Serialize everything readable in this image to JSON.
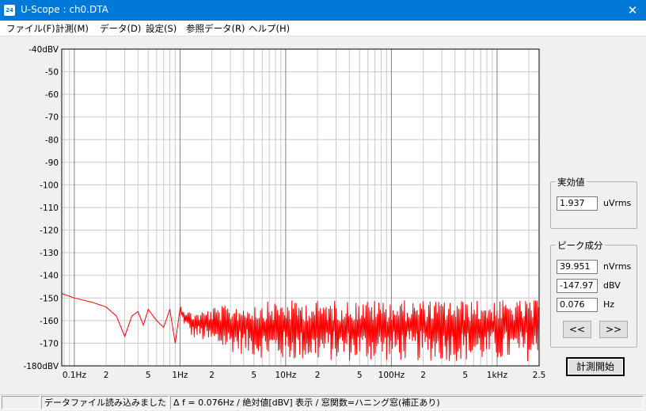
{
  "window": {
    "title": "U-Scope : ch0.DTA",
    "icon_label": "24",
    "close_glyph": "✕"
  },
  "menu": [
    {
      "label": "ファイル(F)"
    },
    {
      "label": "計測(M)"
    },
    {
      "label": "データ(D)"
    },
    {
      "label": "設定(S)"
    },
    {
      "label": "参照データ(R)"
    },
    {
      "label": "ヘルプ(H)"
    }
  ],
  "rms_group": {
    "title": "実効値",
    "value": "1.937",
    "unit": "uVrms"
  },
  "peak_group": {
    "title": "ピーク成分",
    "nvrms_value": "39.951",
    "nvrms_unit": "nVrms",
    "dbv_value": "-147.97",
    "dbv_unit": "dBV",
    "hz_value": "0.076",
    "hz_unit": "Hz",
    "prev_label": "<<",
    "next_label": ">>"
  },
  "start_button": {
    "label": "計測開始"
  },
  "status": {
    "left": "",
    "message": "データファイル読み込みました",
    "info": "Δ f = 0.076Hz / 絶対値[dBV] 表示 / 窓関数=ハニング窓(補正あり)"
  },
  "chart_data": {
    "type": "line",
    "x_scale": "log",
    "xlim": [
      0.076,
      2500
    ],
    "ylim": [
      -180,
      -40
    ],
    "grid": true,
    "line_color": "#ff0000",
    "y_ticks": [
      "-40dBV",
      "-50",
      "-60",
      "-70",
      "-80",
      "-90",
      "-100",
      "-110",
      "-120",
      "-130",
      "-140",
      "-150",
      "-160",
      "-170",
      "-180dBV"
    ],
    "x_ticks": [
      {
        "value": 0.1,
        "label": "0.1Hz"
      },
      {
        "value": 0.2,
        "label": "2"
      },
      {
        "value": 0.5,
        "label": "5"
      },
      {
        "value": 1,
        "label": "1Hz"
      },
      {
        "value": 2,
        "label": "2"
      },
      {
        "value": 5,
        "label": "5"
      },
      {
        "value": 10,
        "label": "10Hz"
      },
      {
        "value": 20,
        "label": "2"
      },
      {
        "value": 50,
        "label": "5"
      },
      {
        "value": 100,
        "label": "100Hz"
      },
      {
        "value": 200,
        "label": "2"
      },
      {
        "value": 500,
        "label": "5"
      },
      {
        "value": 1000,
        "label": "1kHz"
      },
      {
        "value": 2500,
        "label": "2.5"
      }
    ],
    "series": [
      {
        "x": [
          0.076,
          0.1,
          0.15,
          0.2,
          0.25,
          0.3,
          0.35,
          0.4,
          0.45,
          0.5,
          0.6,
          0.7,
          0.8,
          0.9,
          1.0,
          1.1,
          1.3,
          1.5,
          2,
          3,
          5,
          10,
          20,
          50,
          100,
          200,
          500,
          1000,
          2500
        ],
        "y": [
          -148,
          -150,
          -152,
          -154,
          -158,
          -167,
          -158,
          -156,
          -162,
          -155,
          -160,
          -163,
          -155,
          -170,
          -155,
          -157,
          -160,
          -165,
          -162,
          -164,
          -165,
          -165,
          -165,
          -165,
          -165,
          -164,
          -163,
          -163,
          -162
        ],
        "band_low": [
          -148,
          -150,
          -152,
          -154,
          -158,
          -167,
          -158,
          -156,
          -162,
          -155,
          -160,
          -163,
          -155,
          -170,
          -158,
          -162,
          -168,
          -168,
          -172,
          -174,
          -176,
          -178,
          -178,
          -178,
          -178,
          -178,
          -178,
          -178,
          -178
        ],
        "band_high": [
          -148,
          -150,
          -152,
          -154,
          -158,
          -167,
          -158,
          -156,
          -162,
          -155,
          -160,
          -163,
          -155,
          -170,
          -153,
          -155,
          -156,
          -156,
          -154,
          -153,
          -152,
          -151,
          -151,
          -151,
          -151,
          -151,
          -151,
          -151,
          -151
        ]
      }
    ]
  }
}
